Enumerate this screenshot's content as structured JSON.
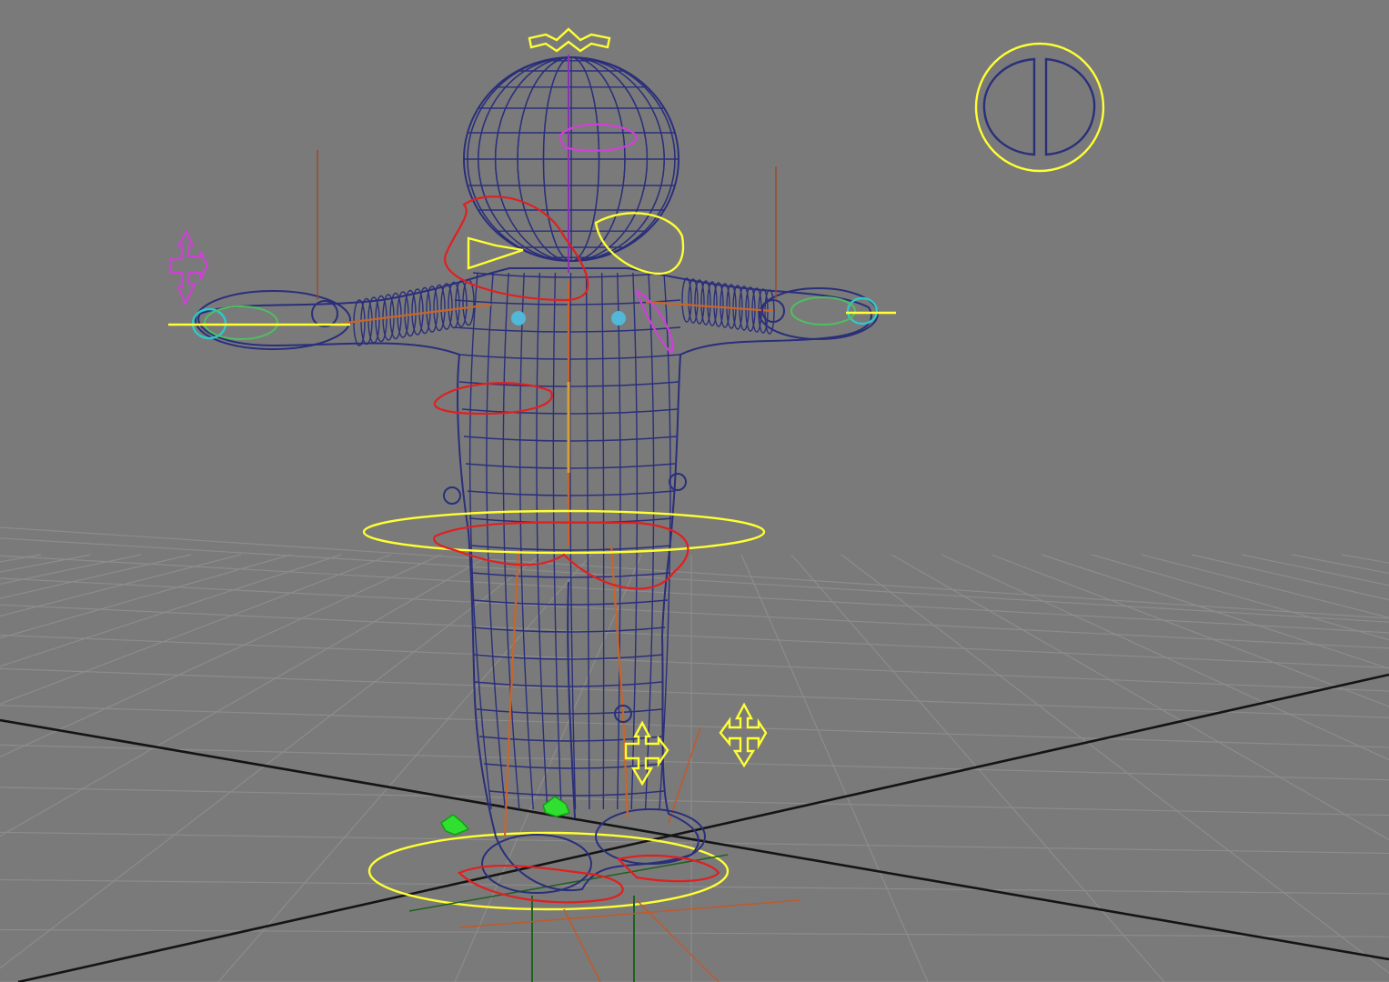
{
  "viewport": {
    "mode": "wireframe",
    "content": "rigged-character",
    "colors": {
      "background": "#7a7a7a",
      "grid": "#8c8c8c",
      "world_axis": "#141414",
      "mesh_wireframe": "#2a2f7a",
      "control_curve_selected": "#ffff33",
      "control_curve_fk": "#e02020",
      "control_curve_ik": "#d040d8",
      "joint": "#c8652a",
      "foot_locator": "#30e030"
    },
    "icons": {
      "head_control": "crown-arrow-icon",
      "mode_switch": "circle-split-icon",
      "pole_vector_left": "move-arrows-icon",
      "pole_vector_knee_left": "move-arrows-icon",
      "pole_vector_knee_right": "move-arrows-icon"
    }
  }
}
